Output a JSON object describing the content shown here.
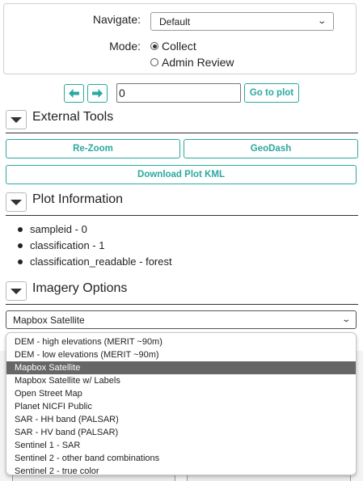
{
  "settings": {
    "navigate_label": "Navigate:",
    "navigate_value": "Default",
    "mode_label": "Mode:",
    "mode_options": [
      {
        "label": "Collect",
        "selected": true
      },
      {
        "label": "Admin Review",
        "selected": false
      }
    ]
  },
  "navigation": {
    "prev_icon": "arrow-left-icon",
    "next_icon": "arrow-right-icon",
    "plot_input_value": "0",
    "go_to_plot_label": "Go to plot"
  },
  "external_tools": {
    "title": "External Tools",
    "buttons": {
      "rezoom": "Re-Zoom",
      "geodash": "GeoDash",
      "download_kml": "Download Plot KML"
    }
  },
  "plot_information": {
    "title": "Plot Information",
    "items": [
      "sampleid - 0",
      "classification - 1",
      "classification_readable - forest"
    ]
  },
  "imagery_options": {
    "title": "Imagery Options",
    "selected": "Mapbox Satellite",
    "options": [
      "DEM - high elevations (MERIT ~90m)",
      "DEM - low elevations (MERIT ~90m)",
      "Mapbox Satellite",
      "Mapbox Satellite w/ Labels",
      "Open Street Map",
      "Planet NICFI Public",
      "SAR - HH band (PALSAR)",
      "SAR - HV band (PALSAR)",
      "Sentinel 1 - SAR",
      "Sentinel 2 - other band combinations",
      "Sentinel 2 - true color"
    ]
  },
  "colors": {
    "accent": "#2ba9a0",
    "highlight": "#666666"
  }
}
